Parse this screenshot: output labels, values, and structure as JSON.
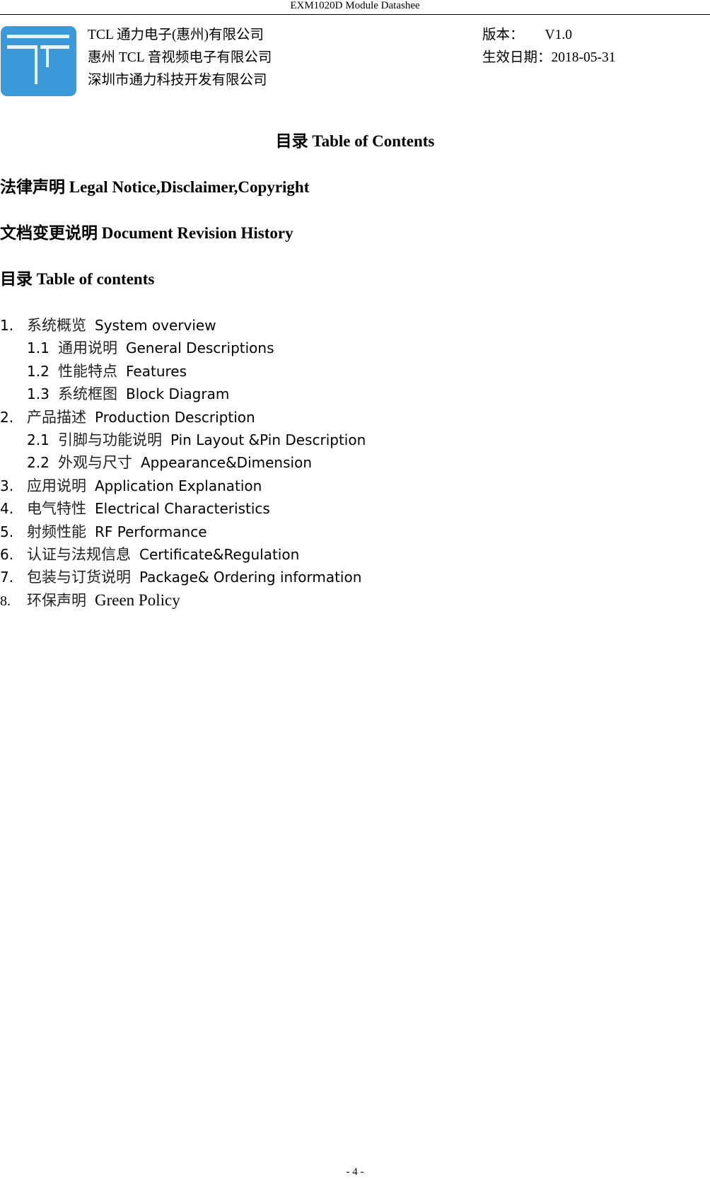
{
  "running_header": "EXM1020D Module Datashee",
  "logo": {
    "icon": "tcl-t-logo-icon",
    "color": "#3a9ad9"
  },
  "companies": [
    "TCL 通力电子(惠州)有限公司",
    "惠州 TCL 音视频电子有限公司",
    "深圳市通力科技开发有限公司"
  ],
  "version": {
    "label": "版本：",
    "value": "V1.0"
  },
  "effective_date": {
    "label": "生效日期：",
    "value": "2018-05-31"
  },
  "toc_title": "目录  Table of Contents",
  "section_headings": [
    "法律声明 Legal Notice,Disclaimer,Copyright",
    "文档变更说明 Document Revision History",
    "目录 Table of contents"
  ],
  "toc": [
    {
      "level": 1,
      "num": "1.",
      "cn": "系统概览",
      "en": "System overview"
    },
    {
      "level": 2,
      "num": "1.1",
      "cn": "通用说明",
      "en": "General Descriptions"
    },
    {
      "level": 2,
      "num": "1.2",
      "cn": "性能特点",
      "en": "Features"
    },
    {
      "level": 2,
      "num": "1.3",
      "cn": "系统框图",
      "en": "Block Diagram"
    },
    {
      "level": 1,
      "num": "2.",
      "cn": "产品描述",
      "en": "Production Description"
    },
    {
      "level": 2,
      "num": "2.1",
      "cn": "引脚与功能说明",
      "en": "Pin Layout &Pin Description"
    },
    {
      "level": 2,
      "num": "2.2",
      "cn": "外观与尺寸",
      "en": "Appearance&Dimension"
    },
    {
      "level": 1,
      "num": "3.",
      "cn": "应用说明",
      "en": "Application Explanation"
    },
    {
      "level": 1,
      "num": "4.",
      "cn": "电气特性",
      "en": "Electrical Characteristics"
    },
    {
      "level": 1,
      "num": "5.",
      "cn": "射频性能",
      "en": "RF Performance"
    },
    {
      "level": 1,
      "num": "6.",
      "cn": "认证与法规信息",
      "en": "Certificate&Regulation"
    },
    {
      "level": 1,
      "num": "7.",
      "cn": "包装与订货说明",
      "en": "Package& Ordering information"
    },
    {
      "level": 1,
      "num": "8.",
      "cn": "环保声明",
      "en": "Green Policy"
    }
  ],
  "page_number": "- 4 -"
}
